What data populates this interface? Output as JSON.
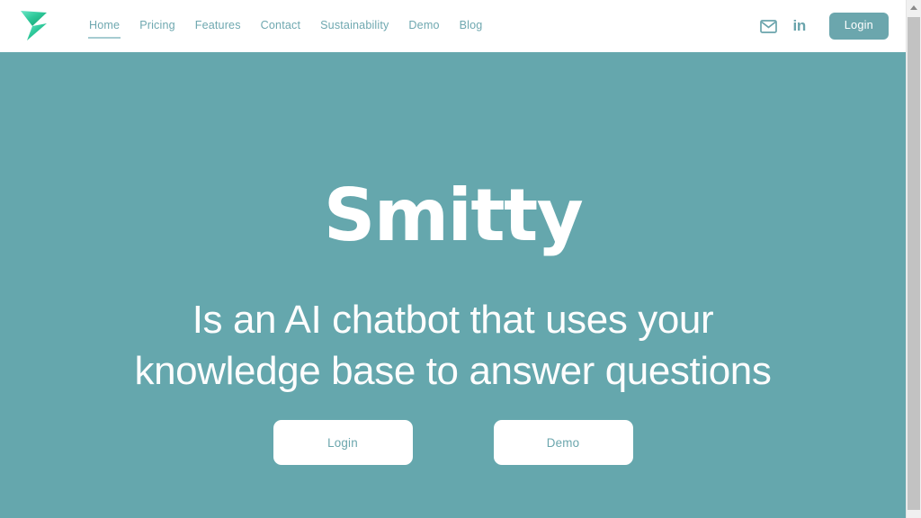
{
  "window": {
    "title": "Smitty",
    "scrollbar": {
      "up_arrow_icon": "triangle-up-icon",
      "thumb_label": ""
    }
  },
  "theme": {
    "hero_background": "#65a7ad",
    "accent_teal": "#6ba6ad",
    "nav_link_color": "#6fa8b0",
    "nav_underline_color": "#a6ccd1",
    "button_text_on_white": "#6ba6ad",
    "logo_gradient_from": "#4fd1b0",
    "logo_gradient_to": "#1fa97a",
    "white": "#ffffff"
  },
  "header": {
    "logo": {
      "icon": "hourglass-bowtie-logo-icon",
      "alt": "Smitty"
    },
    "nav": [
      {
        "label": "Home",
        "active": true
      },
      {
        "label": "Pricing",
        "active": false
      },
      {
        "label": "Features",
        "active": false
      },
      {
        "label": "Contact",
        "active": false
      },
      {
        "label": "Sustainability",
        "active": false
      },
      {
        "label": "Demo",
        "active": false
      },
      {
        "label": "Blog",
        "active": false
      }
    ],
    "social": [
      {
        "icon": "mail-icon",
        "label": ""
      },
      {
        "icon": "linkedin-icon",
        "label": "in"
      }
    ],
    "login_button": {
      "label": "Login"
    }
  },
  "hero": {
    "title": "Smitty",
    "subtitle": "Is an AI chatbot that uses your knowledge base to answer questions",
    "actions": [
      {
        "label": "Login"
      },
      {
        "label": "Demo"
      }
    ]
  }
}
